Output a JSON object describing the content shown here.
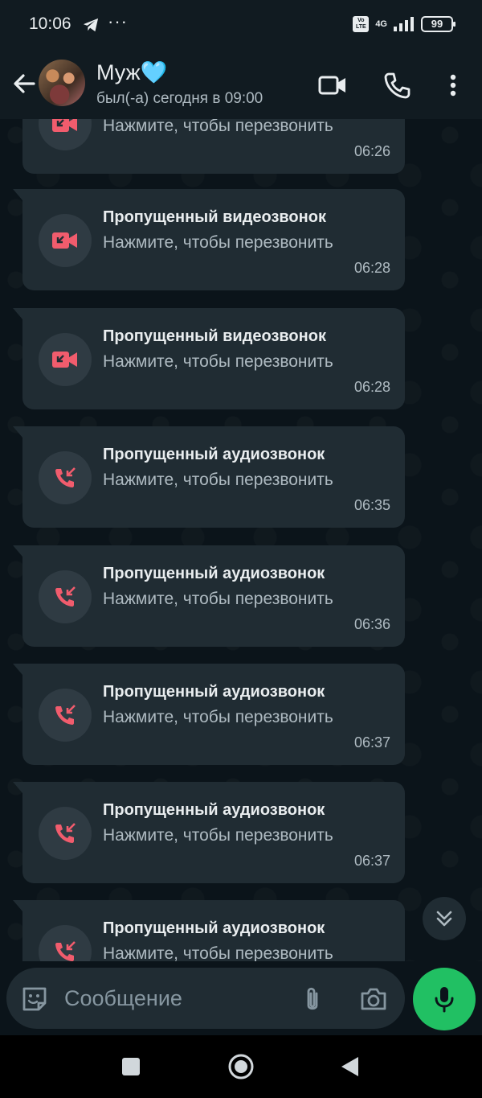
{
  "status_bar": {
    "time": "10:06",
    "more": "···",
    "network": "4G",
    "battery": "99"
  },
  "header": {
    "contact_name": "Муж🩵",
    "contact_status": "был(-а) сегодня в 09:00"
  },
  "messages": [
    {
      "title": "",
      "subtitle": "Нажмите, чтобы перезвонить",
      "time": "06:26",
      "kind": "video"
    },
    {
      "title": "Пропущенный видеозвонок",
      "subtitle": "Нажмите, чтобы перезвонить",
      "time": "06:28",
      "kind": "video"
    },
    {
      "title": "Пропущенный видеозвонок",
      "subtitle": "Нажмите, чтобы перезвонить",
      "time": "06:28",
      "kind": "video"
    },
    {
      "title": "Пропущенный аудиозвонок",
      "subtitle": "Нажмите, чтобы перезвонить",
      "time": "06:35",
      "kind": "audio"
    },
    {
      "title": "Пропущенный аудиозвонок",
      "subtitle": "Нажмите, чтобы перезвонить",
      "time": "06:36",
      "kind": "audio"
    },
    {
      "title": "Пропущенный аудиозвонок",
      "subtitle": "Нажмите, чтобы перезвонить",
      "time": "06:37",
      "kind": "audio"
    },
    {
      "title": "Пропущенный аудиозвонок",
      "subtitle": "Нажмите, чтобы перезвонить",
      "time": "06:37",
      "kind": "audio"
    },
    {
      "title": "Пропущенный аудиозвонок",
      "subtitle": "Нажмите, чтобы перезвонить",
      "time": "",
      "kind": "audio"
    }
  ],
  "input": {
    "placeholder": "Сообщение"
  },
  "colors": {
    "missed_call": "#f15c6d",
    "accent_green": "#21c063",
    "bubble": "#202c33"
  },
  "icons": [
    "back-arrow-icon",
    "video-call-icon",
    "phone-icon",
    "more-vert-icon",
    "missed-video-call-icon",
    "missed-audio-call-icon",
    "scroll-down-icon",
    "sticker-icon",
    "attach-icon",
    "camera-icon",
    "mic-icon"
  ]
}
